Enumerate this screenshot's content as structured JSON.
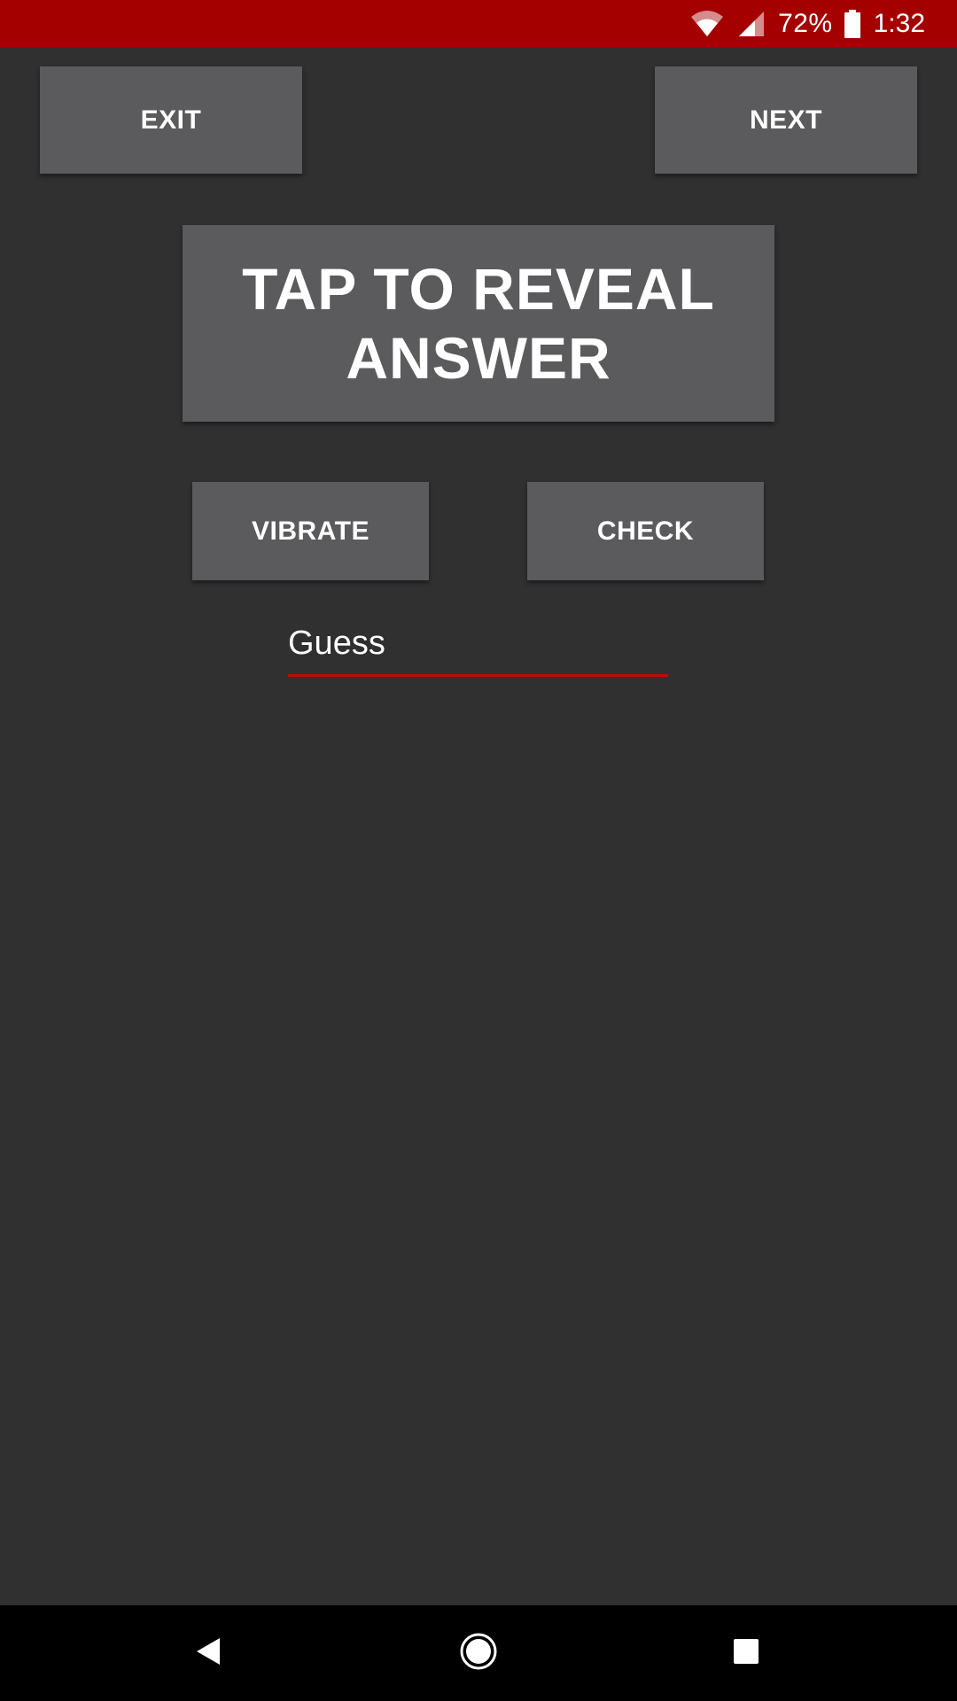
{
  "status_bar": {
    "battery_percent": "72%",
    "time": "1:32",
    "icons": [
      "wifi-icon",
      "signal-icon",
      "battery-icon"
    ],
    "color": "#a50000"
  },
  "toolbar": {
    "exit_label": "EXIT",
    "next_label": "NEXT"
  },
  "main": {
    "reveal_label": "TAP TO REVEAL ANSWER",
    "vibrate_label": "VIBRATE",
    "check_label": "CHECK",
    "guess_placeholder": "Guess"
  },
  "nav_bar": {
    "icons": [
      "back-icon",
      "home-icon",
      "recents-icon"
    ]
  },
  "colors": {
    "background": "#303030",
    "button": "#5b5b5d",
    "accent": "#c4090e",
    "text": "#ffffff"
  }
}
